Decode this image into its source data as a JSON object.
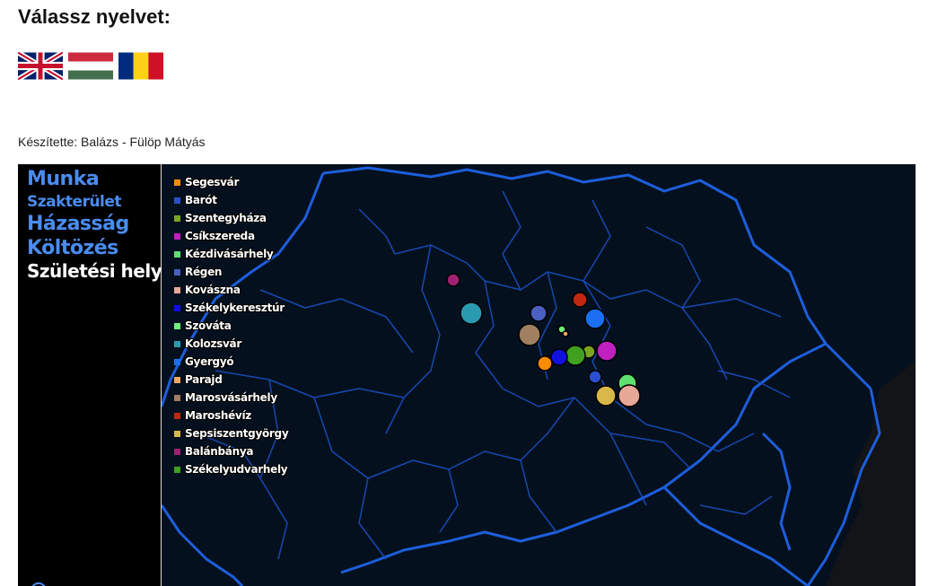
{
  "header": {
    "title": "Válassz nyelvet:"
  },
  "languages": [
    {
      "name": "English",
      "flag": "uk-flag-icon"
    },
    {
      "name": "Magyar",
      "flag": "hungary-flag-icon"
    },
    {
      "name": "Română",
      "flag": "romania-flag-icon"
    }
  ],
  "credit": "Készítette: Balázs - Fülöp Mátyás",
  "sidebar": {
    "items": [
      {
        "label": "Munka",
        "active": false
      },
      {
        "label": "Szakterület",
        "active": false
      },
      {
        "label": "Házasság",
        "active": false
      },
      {
        "label": "Költözés",
        "active": false
      },
      {
        "label": "Születési hely",
        "active": true
      }
    ]
  },
  "legend": [
    {
      "label": "Segesvár",
      "color": "#ff8c00"
    },
    {
      "label": "Barót",
      "color": "#2b4fcf"
    },
    {
      "label": "Szentegyháza",
      "color": "#7aa520"
    },
    {
      "label": "Csíkszereda",
      "color": "#c020c0"
    },
    {
      "label": "Kézdivásárhely",
      "color": "#5ee06e"
    },
    {
      "label": "Régen",
      "color": "#4a5fc0"
    },
    {
      "label": "Kovászna",
      "color": "#e8a898"
    },
    {
      "label": "Székelykeresztúr",
      "color": "#1010e0"
    },
    {
      "label": "Szováta",
      "color": "#6ef07a"
    },
    {
      "label": "Kolozsvár",
      "color": "#2a9ab0"
    },
    {
      "label": "Gyergyó",
      "color": "#1a70f0"
    },
    {
      "label": "Parajd",
      "color": "#f0a860"
    },
    {
      "label": "Marosvásárhely",
      "color": "#a08060"
    },
    {
      "label": "Maroshévíz",
      "color": "#c02810"
    },
    {
      "label": "Sepsiszentgyörgy",
      "color": "#d8b848"
    },
    {
      "label": "Balánbánya",
      "color": "#a02070"
    },
    {
      "label": "Székelyudvarhely",
      "color": "#40a020"
    }
  ],
  "colors": {
    "map_background": "#05101f",
    "border_line": "#1f63e6",
    "accent": "#4a8cf0"
  }
}
